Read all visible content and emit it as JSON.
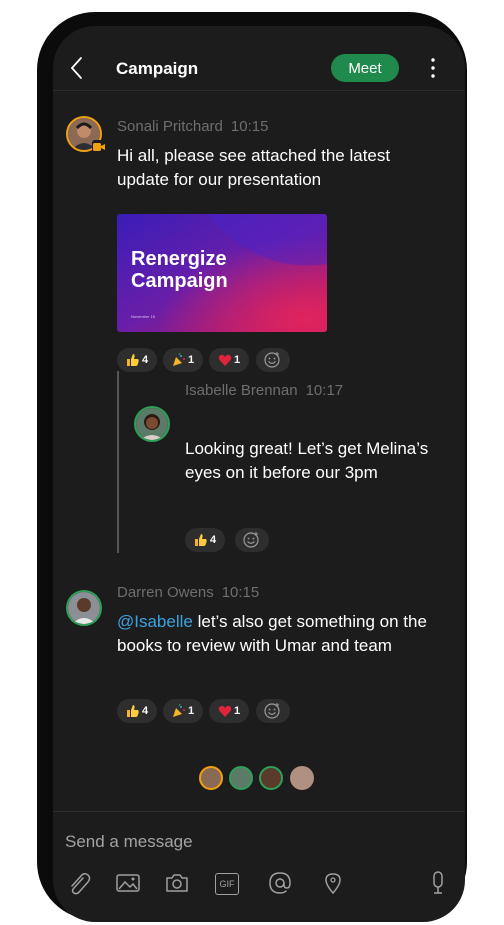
{
  "header": {
    "title": "Campaign",
    "meet_label": "Meet"
  },
  "messages": [
    {
      "sender": "Sonali Pritchard",
      "time": "10:15",
      "text": "Hi all, please see attached the latest update for our presentation",
      "attachment": {
        "title": "Renergize Campaign",
        "date": "November 15"
      },
      "reactions": [
        {
          "emoji": "thumbs-up",
          "count": "4"
        },
        {
          "emoji": "party-popper",
          "count": "1"
        },
        {
          "emoji": "heart",
          "count": "1"
        }
      ]
    },
    {
      "sender": "Isabelle Brennan",
      "time": "10:17",
      "text": "Looking great! Let’s get Melina’s eyes on it before our 3pm",
      "reactions": [
        {
          "emoji": "thumbs-up",
          "count": "4"
        }
      ]
    },
    {
      "sender": "Darren Owens",
      "time": "10:15",
      "mention": "@Isabelle",
      "text": " let’s also get something on the books to review with Umar and team",
      "reactions": [
        {
          "emoji": "thumbs-up",
          "count": "4"
        },
        {
          "emoji": "party-popper",
          "count": "1"
        },
        {
          "emoji": "heart",
          "count": "1"
        }
      ]
    }
  ],
  "composer": {
    "placeholder": "Send a message",
    "gif_label": "GIF"
  },
  "colors": {
    "background": "#1c1c1c",
    "meet_button": "#1f8a4c",
    "mention": "#3ba3e0",
    "reaction_chip": "#2e2e2e",
    "presence_green": "#2ea05a",
    "presence_orange": "#f0a010"
  }
}
